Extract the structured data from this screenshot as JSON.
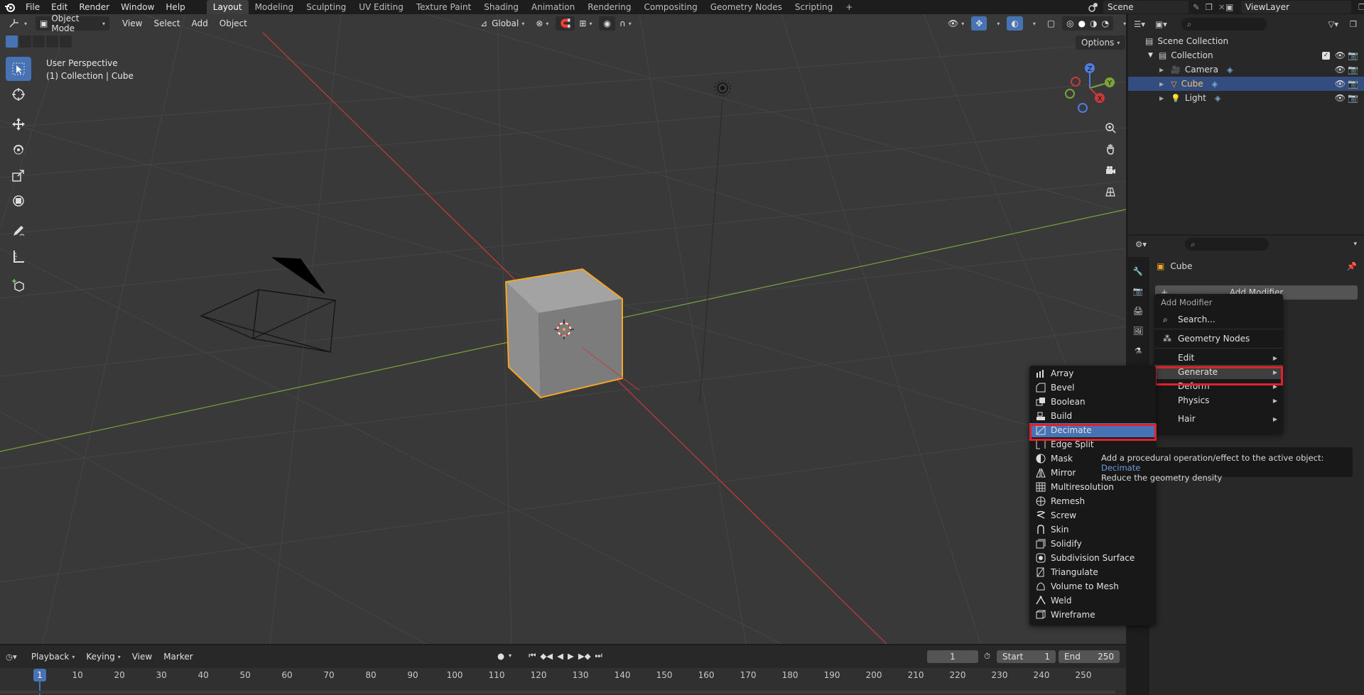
{
  "topbar": {
    "menus": [
      "File",
      "Edit",
      "Render",
      "Window",
      "Help"
    ],
    "workspaces": [
      "Layout",
      "Modeling",
      "Sculpting",
      "UV Editing",
      "Texture Paint",
      "Shading",
      "Animation",
      "Rendering",
      "Compositing",
      "Geometry Nodes",
      "Scripting"
    ],
    "active_workspace": "Layout",
    "add_workspace": "+",
    "scene": "Scene",
    "view_layer": "ViewLayer"
  },
  "viewport": {
    "mode": "Object Mode",
    "menus": [
      "View",
      "Select",
      "Add",
      "Object"
    ],
    "orientation": "Global",
    "options": "Options",
    "perspective_label": "User Perspective",
    "collection_label": "(1) Collection | Cube",
    "gizmo": {
      "z": "Z",
      "y": "Y",
      "x": "X"
    }
  },
  "outliner": {
    "scene_collection": "Scene Collection",
    "collection": "Collection",
    "items": [
      {
        "label": "Camera",
        "selected": false
      },
      {
        "label": "Cube",
        "selected": true
      },
      {
        "label": "Light",
        "selected": false
      }
    ]
  },
  "properties": {
    "object_name": "Cube",
    "add_modifier": "Add Modifier"
  },
  "add_modifier_menu": {
    "title": "Add Modifier",
    "search": "Search...",
    "geometry_nodes": "Geometry Nodes",
    "items": [
      "Edit",
      "Generate",
      "Deform",
      "Physics",
      "Hair"
    ],
    "highlighted": "Generate"
  },
  "generate_menu": {
    "items": [
      "Array",
      "Bevel",
      "Boolean",
      "Build",
      "Decimate",
      "Edge Split",
      "Mask",
      "Mirror",
      "Multiresolution",
      "Remesh",
      "Screw",
      "Skin",
      "Solidify",
      "Subdivision Surface",
      "Triangulate",
      "Volume to Mesh",
      "Weld",
      "Wireframe"
    ],
    "highlighted": "Decimate"
  },
  "tooltip": {
    "line1": "Add a procedural operation/effect to the active object:",
    "line1_accent": "Decimate",
    "line2": "Reduce the geometry density"
  },
  "timeline": {
    "menus": [
      "Playback",
      "Keying",
      "View",
      "Marker"
    ],
    "current_frame": "1",
    "start_label": "Start",
    "start_value": "1",
    "end_label": "End",
    "end_value": "250",
    "ruler": [
      "1",
      "10",
      "20",
      "30",
      "40",
      "50",
      "60",
      "70",
      "80",
      "90",
      "100",
      "110",
      "120",
      "130",
      "140",
      "150",
      "160",
      "170",
      "180",
      "190",
      "200",
      "210",
      "220",
      "230",
      "240",
      "250"
    ]
  },
  "colors": {
    "accent": "#4772b3",
    "selection_outline": "#f5a623",
    "highlight_box": "#e0202a",
    "x_axis": "#c83a3a",
    "y_axis": "#7aa33a"
  }
}
